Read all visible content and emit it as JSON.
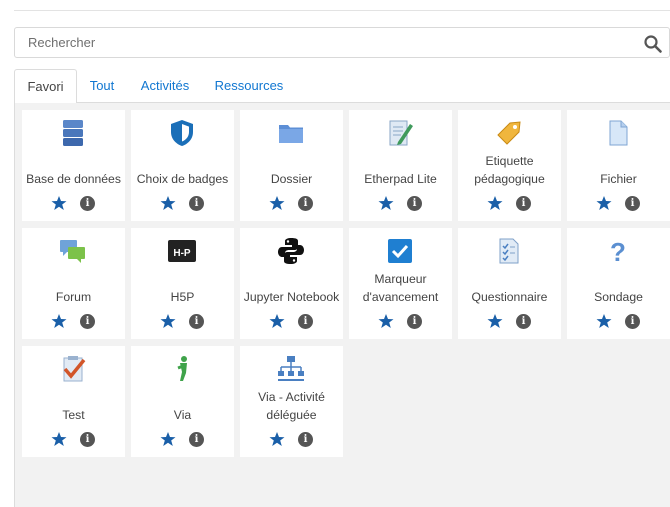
{
  "search": {
    "placeholder": "Rechercher",
    "icon": "search-icon"
  },
  "tabs": [
    {
      "label": "Favori",
      "active": true
    },
    {
      "label": "Tout",
      "active": false
    },
    {
      "label": "Activités",
      "active": false
    },
    {
      "label": "Ressources",
      "active": false
    }
  ],
  "modules": [
    {
      "label": "Base de données",
      "icon": "database-icon"
    },
    {
      "label": "Choix de badges",
      "icon": "shield-icon"
    },
    {
      "label": "Dossier",
      "icon": "folder-icon"
    },
    {
      "label": "Etherpad Lite",
      "icon": "notepad-pencil-icon"
    },
    {
      "label": "Etiquette pédagogique",
      "icon": "tag-icon"
    },
    {
      "label": "Fichier",
      "icon": "file-icon"
    },
    {
      "label": "Forum",
      "icon": "chat-bubbles-icon"
    },
    {
      "label": "H5P",
      "icon": "h5p-logo-icon"
    },
    {
      "label": "Jupyter Notebook",
      "icon": "python-logo-icon"
    },
    {
      "label": "Marqueur d'avancement",
      "icon": "checkbox-icon"
    },
    {
      "label": "Questionnaire",
      "icon": "checklist-icon"
    },
    {
      "label": "Sondage",
      "icon": "question-mark-icon"
    },
    {
      "label": "Test",
      "icon": "check-paper-icon"
    },
    {
      "label": "Via",
      "icon": "via-figure-icon"
    },
    {
      "label": "Via - Activité déléguée",
      "icon": "org-chart-icon"
    }
  ],
  "colors": {
    "accent": "#1177d1",
    "star": "#1a5fa8",
    "info": "#555555",
    "panel": "#f2f2f2"
  }
}
